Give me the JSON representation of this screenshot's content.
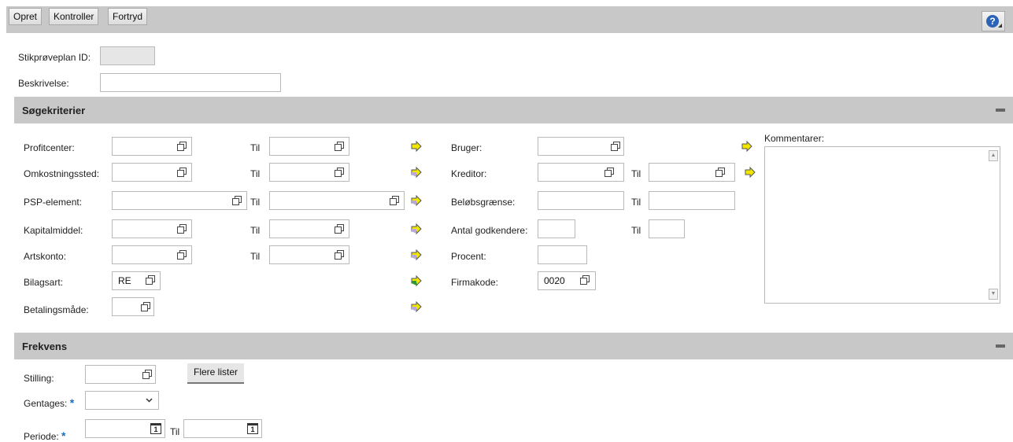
{
  "toolbar": {
    "create_label": "Opret",
    "check_label": "Kontroller",
    "undo_label": "Fortryd"
  },
  "header": {
    "plan_id_label": "Stikprøveplan ID:",
    "plan_id_value": "",
    "description_label": "Beskrivelse:",
    "description_value": ""
  },
  "search_section": {
    "title": "Søgekriterier",
    "to_label": "Til",
    "left_rows": {
      "profitcenter": "Profitcenter:",
      "cost_center": "Omkostningssted:",
      "wbs_element": "PSP-element:",
      "asset": "Kapitalmiddel:",
      "gl_account": "Artskonto:",
      "doc_type": "Bilagsart:",
      "doc_type_value": "RE",
      "payment_method": "Betalingsmåde:"
    },
    "right_rows": {
      "user": "Bruger:",
      "vendor": "Kreditor:",
      "amount_limit": "Beløbsgrænse:",
      "approver_count": "Antal godkendere:",
      "percent": "Procent:",
      "company_code": "Firmakode:",
      "company_code_value": "0020"
    },
    "comments_label": "Kommentarer:"
  },
  "frequency_section": {
    "title": "Frekvens",
    "position_label": "Stilling:",
    "more_lists_label": "Flere lister",
    "repeat_label": "Gentages:",
    "period_label": "Periode:",
    "to_label": "Til",
    "required_marker": "*",
    "calendar_day": "1"
  },
  "colors": {
    "section_bg": "#c8c8c8",
    "required": "#1a6fc2",
    "arrow_yellow": "#f2e600",
    "arrow_green": "#2e9a2e",
    "arrow_grey": "#9a8fb0"
  }
}
